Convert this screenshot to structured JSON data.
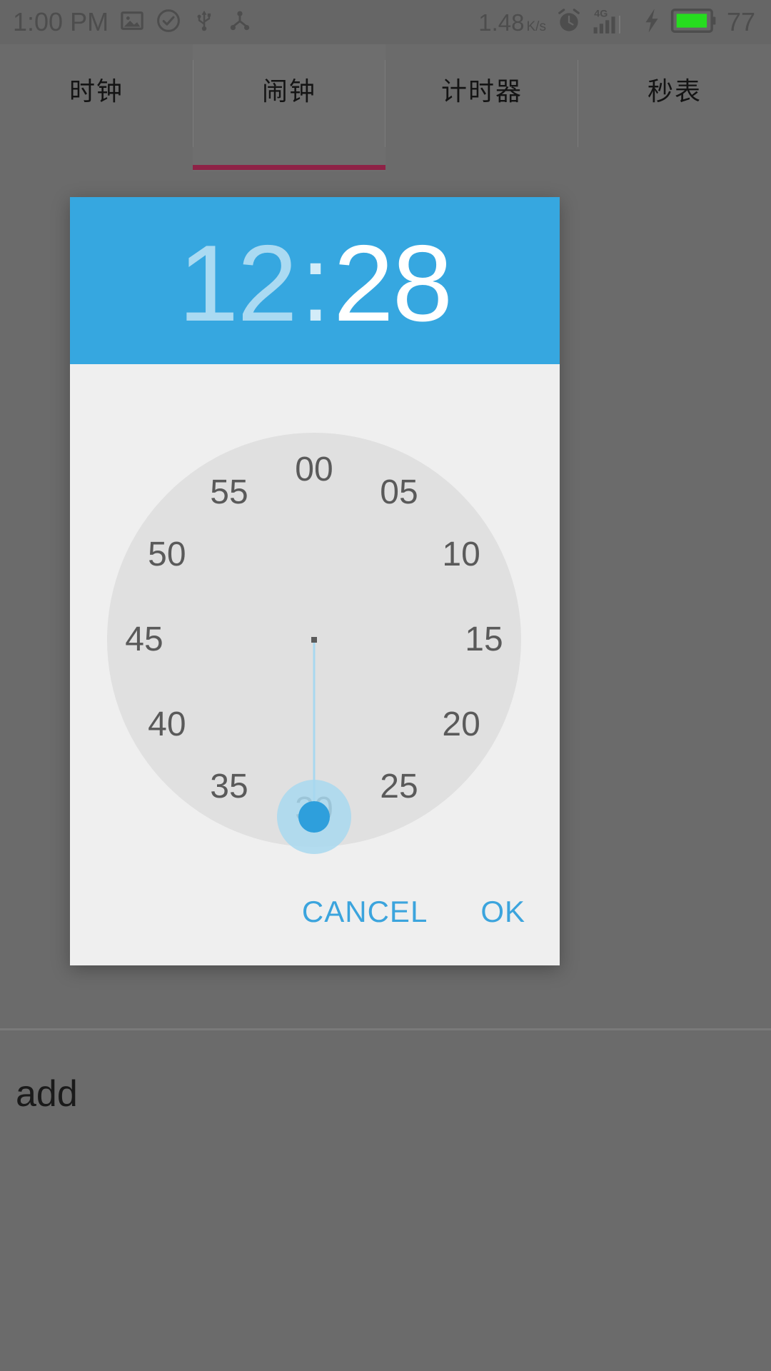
{
  "status_bar": {
    "clock": "1:00 PM",
    "icons_left": [
      "image-icon",
      "check-circle-icon",
      "usb-icon",
      "share-nodes-icon"
    ],
    "network_speed": "1.48",
    "network_speed_unit": "K/s",
    "icons_right": [
      "alarm-icon",
      "signal-4g-icon",
      "charging-bolt-icon",
      "battery-icon"
    ],
    "network_type": "4G",
    "battery_percent": "77",
    "battery_color": "#26dd1f",
    "background": "#666666"
  },
  "tabs": {
    "items": [
      {
        "label": "时钟",
        "selected": false
      },
      {
        "label": "闹钟",
        "selected": true
      },
      {
        "label": "计时器",
        "selected": false
      },
      {
        "label": "秒表",
        "selected": false
      }
    ],
    "indicator_color": "#8e2246"
  },
  "dialog": {
    "name": "time-picker-dialog",
    "accent_color": "#36a7e0",
    "header": {
      "hours": "12",
      "separator": ":",
      "minutes": "28",
      "active_field": "minutes"
    },
    "clock": {
      "mode": "minutes",
      "selected_value": "30",
      "hand_angle_degrees": 180,
      "face_color": "#e0e0e0",
      "selector_color": "#2e9fdc",
      "halo_color": "#a8d8ef",
      "labels": [
        {
          "text": "00",
          "angle": 0
        },
        {
          "text": "05",
          "angle": 30
        },
        {
          "text": "10",
          "angle": 60
        },
        {
          "text": "15",
          "angle": 90
        },
        {
          "text": "20",
          "angle": 120
        },
        {
          "text": "25",
          "angle": 150
        },
        {
          "text": "30",
          "angle": 180
        },
        {
          "text": "35",
          "angle": 210
        },
        {
          "text": "40",
          "angle": 240
        },
        {
          "text": "45",
          "angle": 270
        },
        {
          "text": "50",
          "angle": 300
        },
        {
          "text": "55",
          "angle": 330
        }
      ]
    },
    "actions": {
      "cancel_label": "CANCEL",
      "ok_label": "OK"
    }
  },
  "bottom": {
    "add_label": "add"
  }
}
